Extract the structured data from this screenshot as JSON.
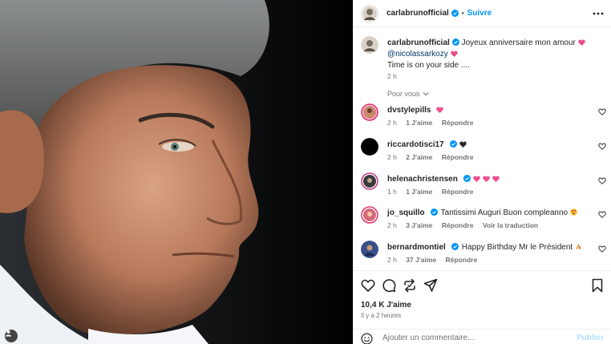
{
  "header": {
    "username": "carlabrunofficial",
    "separator": "•",
    "follow_label": "Suivre",
    "more_icon": "more-horizontal-icon"
  },
  "caption": {
    "username": "carlabrunofficial",
    "text": "Joyeux anniversaire mon amour",
    "mention": "@nicolassarkozy",
    "text2": "Time is on your side ....",
    "time": "2 h"
  },
  "for_you_label": "Pour vous",
  "comments": [
    {
      "username": "dvstylepills",
      "text": "",
      "emoji": "pink-heart",
      "time": "2 h",
      "likes": "1 J'aime",
      "reply": "Répondre",
      "translate": "",
      "avatar_color": "#c98a6a"
    },
    {
      "username": "riccardotisci17",
      "text": "",
      "emoji": "black-heart",
      "time": "2 h",
      "likes": "2 J'aime",
      "reply": "Répondre",
      "translate": "",
      "avatar_color": "#000000"
    },
    {
      "username": "helenachristensen",
      "text": "",
      "emoji": "three-pink-hearts",
      "time": "1 h",
      "likes": "1 J'aime",
      "reply": "Répondre",
      "translate": "",
      "avatar_color": "#3a3a3a"
    },
    {
      "username": "jo_squillo",
      "text": "Tantissimi Auguri Buon compleanno",
      "emoji": "heart-eyes",
      "time": "2 h",
      "likes": "3 J'aime",
      "reply": "Répondre",
      "translate": "Voir la traduction",
      "avatar_color": "#d36a7a"
    },
    {
      "username": "bernardmontiel",
      "text": "Happy Birthday Mr le Président",
      "emoji": "praying-hands",
      "time": "2 h",
      "likes": "37 J'aime",
      "reply": "Répondre",
      "translate": "",
      "avatar_color": "#3a4f8a"
    }
  ],
  "actions": {
    "likes_count": "10,4 K J'aime",
    "time_ago": "Il y a 2 heures"
  },
  "add_comment": {
    "placeholder": "Ajouter un commentaire...",
    "post_label": "Publier"
  },
  "colors": {
    "accent": "#0095f6",
    "link": "#00376b",
    "verified": "#0095f6",
    "heart_pink": "#ed4c8c"
  }
}
